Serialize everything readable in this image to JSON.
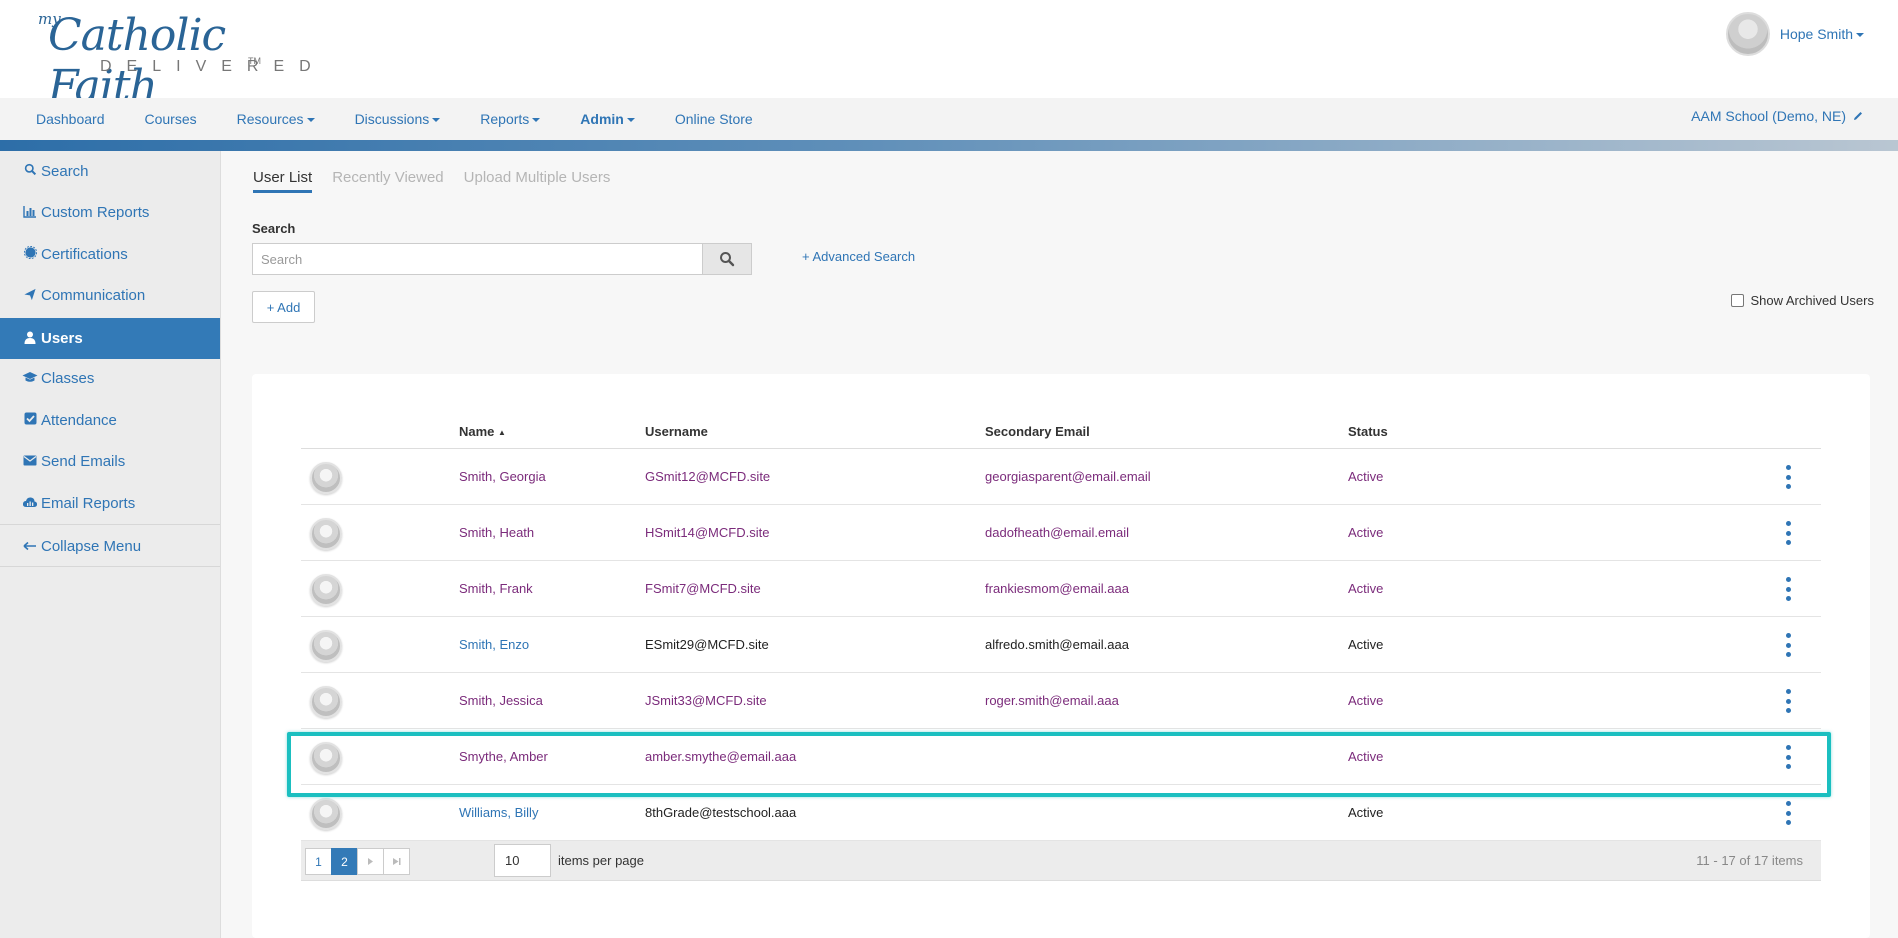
{
  "brand": {
    "my": "my",
    "catholic_faith": "Catholic Faith",
    "delivered": "DELIVERED",
    "tm": "TM"
  },
  "user": {
    "name": "Hope Smith"
  },
  "nav": {
    "items": [
      {
        "label": "Dashboard",
        "dropdown": false,
        "bold": false
      },
      {
        "label": "Courses",
        "dropdown": false,
        "bold": false
      },
      {
        "label": "Resources",
        "dropdown": true,
        "bold": false
      },
      {
        "label": "Discussions",
        "dropdown": true,
        "bold": false
      },
      {
        "label": "Reports",
        "dropdown": true,
        "bold": false
      },
      {
        "label": "Admin",
        "dropdown": true,
        "bold": true
      },
      {
        "label": "Online Store",
        "dropdown": false,
        "bold": false
      }
    ],
    "school": "AAM School (Demo, NE)"
  },
  "sidebar": {
    "items": [
      {
        "label": "Search",
        "icon": "search-icon"
      },
      {
        "label": "Custom Reports",
        "icon": "bar-chart-icon"
      },
      {
        "label": "Certifications",
        "icon": "certificate-icon"
      },
      {
        "label": "Communication",
        "icon": "paper-plane-icon"
      },
      {
        "label": "Users",
        "icon": "user-icon",
        "active": true
      },
      {
        "label": "Classes",
        "icon": "graduation-cap-icon"
      },
      {
        "label": "Attendance",
        "icon": "checkbox-icon"
      },
      {
        "label": "Send Emails",
        "icon": "envelope-icon"
      },
      {
        "label": "Email Reports",
        "icon": "cloud-chart-icon"
      }
    ],
    "collapse": "Collapse Menu"
  },
  "tabs": [
    {
      "label": "User List",
      "active": true
    },
    {
      "label": "Recently Viewed",
      "active": false
    },
    {
      "label": "Upload Multiple Users",
      "active": false
    }
  ],
  "search": {
    "label": "Search",
    "placeholder": "Search",
    "advanced": "+ Advanced Search"
  },
  "add_label": "+ Add",
  "archived_label": "Show Archived Users",
  "table": {
    "headers": {
      "name": "Name",
      "username": "Username",
      "email": "Secondary Email",
      "status": "Status"
    },
    "rows": [
      {
        "name": "Smith, Georgia",
        "username": "GSmit12@MCFD.site",
        "email": "georgiasparent@email.email",
        "status": "Active",
        "visited": true
      },
      {
        "name": "Smith, Heath",
        "username": "HSmit14@MCFD.site",
        "email": "dadofheath@email.email",
        "status": "Active",
        "visited": true
      },
      {
        "name": "Smith, Frank",
        "username": "FSmit7@MCFD.site",
        "email": "frankiesmom@email.aaa",
        "status": "Active",
        "visited": true
      },
      {
        "name": "Smith, Enzo",
        "username": "ESmit29@MCFD.site",
        "email": "alfredo.smith@email.aaa",
        "status": "Active",
        "visited": false
      },
      {
        "name": "Smith, Jessica",
        "username": "JSmit33@MCFD.site",
        "email": "roger.smith@email.aaa",
        "status": "Active",
        "visited": true
      },
      {
        "name": "Smythe, Amber",
        "username": "amber.smythe@email.aaa",
        "email": "",
        "status": "Active",
        "visited": true
      },
      {
        "name": "Williams, Billy",
        "username": "8thGrade@testschool.aaa",
        "email": "",
        "status": "Active",
        "visited": false
      }
    ]
  },
  "pager": {
    "pages": [
      "1",
      "2"
    ],
    "current": "2",
    "per_page": "10",
    "per_page_label": "items per page",
    "info": "11 - 17 of 17 items"
  },
  "colors": {
    "accent": "#337ab7",
    "link": "#2f75b5",
    "visited": "#7b2b7b",
    "highlight": "#1bbfc0"
  }
}
